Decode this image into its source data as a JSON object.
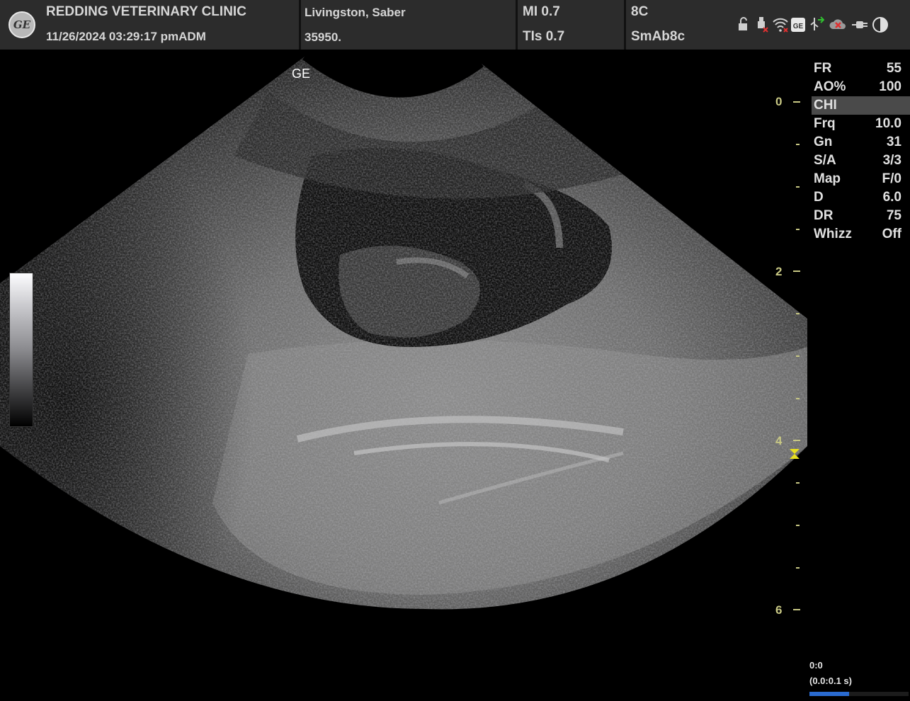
{
  "header": {
    "clinic_name": "REDDING VETERINARY CLINIC",
    "datetime": "11/26/2024 03:29:17 pm",
    "operator": "ADM",
    "patient_name": "Livingston, Saber",
    "patient_id": "35950.",
    "mi": "MI 0.7",
    "tis": "TIs 0.7",
    "probe": "8C",
    "preset": "SmAb8c",
    "logo_text": "GE",
    "status_icons": [
      "lock-icon",
      "usb-icon",
      "wifi-icon",
      "ge-service-icon",
      "network-icon",
      "cloud-offline-icon",
      "power-plug-icon",
      "contrast-icon"
    ]
  },
  "image": {
    "orientation_label": "GE",
    "depth_labels": [
      "0",
      "2",
      "4",
      "6"
    ],
    "focus_marker": "focus-zone-icon"
  },
  "params": [
    {
      "key": "FR",
      "value": "55"
    },
    {
      "key": "AO%",
      "value": "100"
    },
    {
      "key": "CHI",
      "value": ""
    },
    {
      "key": "Frq",
      "value": "10.0"
    },
    {
      "key": "Gn",
      "value": "31"
    },
    {
      "key": "S/A",
      "value": "3/3"
    },
    {
      "key": "Map",
      "value": "F/0"
    },
    {
      "key": "D",
      "value": "6.0"
    },
    {
      "key": "DR",
      "value": "75"
    },
    {
      "key": "Whizz",
      "value": "Off"
    }
  ],
  "cine": {
    "frame": "0:0",
    "range": "(0.0:0.1 s)",
    "progress": 0.4
  },
  "colors": {
    "header_bg": "#2c2c2c",
    "depth_scale": "#c8c884",
    "focus_marker": "#e8e020",
    "cine_progress": "#2a6bd0"
  }
}
